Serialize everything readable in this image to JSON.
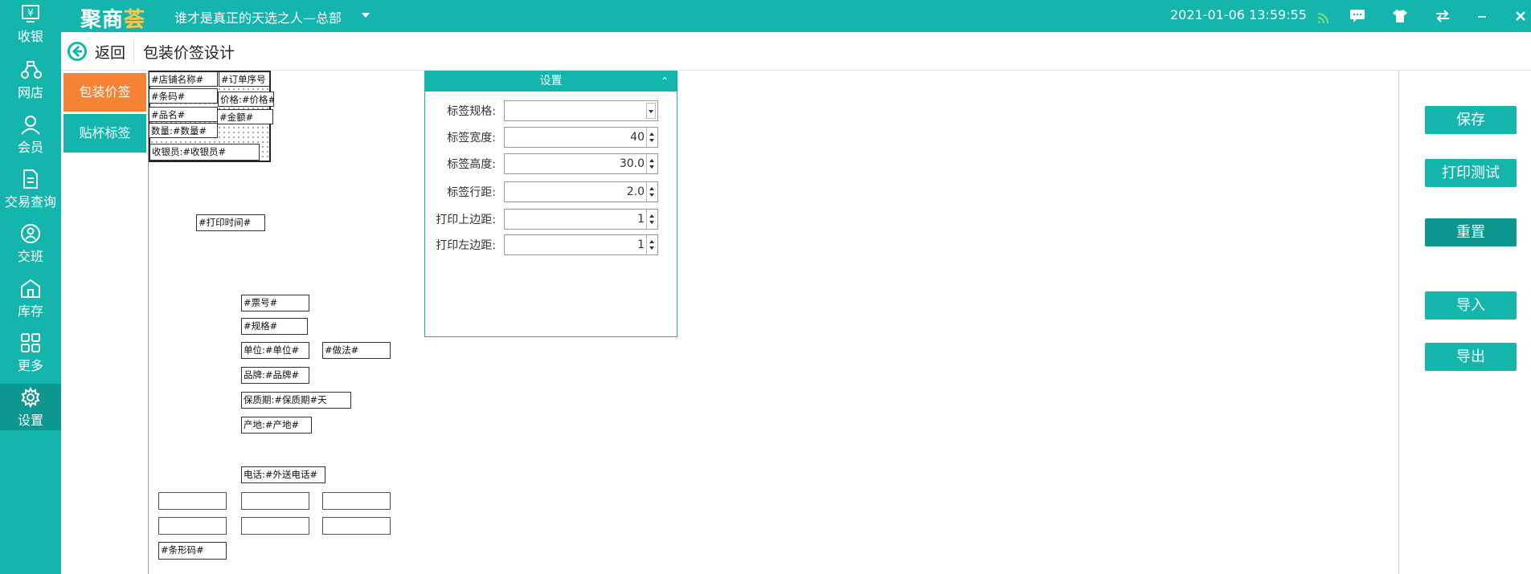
{
  "app": {
    "logo_main": "聚商",
    "logo_accent": "荟"
  },
  "topbar": {
    "store_name": "谁才是真正的天选之人—总部",
    "datetime": "2021-01-06 13:59:55",
    "icons": [
      "wifi-icon",
      "message-icon",
      "shirt-icon",
      "switch-icon",
      "minimize-icon",
      "close-icon"
    ]
  },
  "sidebar": {
    "items": [
      {
        "label": "收银",
        "icon": "cashier-icon"
      },
      {
        "label": "网店",
        "icon": "scooter-icon"
      },
      {
        "label": "会员",
        "icon": "member-icon"
      },
      {
        "label": "交易查询",
        "icon": "document-icon"
      },
      {
        "label": "交班",
        "icon": "shift-icon"
      },
      {
        "label": "库存",
        "icon": "warehouse-icon"
      },
      {
        "label": "更多",
        "icon": "grid-icon"
      },
      {
        "label": "设置",
        "icon": "gear-icon",
        "active": true
      }
    ]
  },
  "header": {
    "back_label": "返回",
    "title": "包装价签设计"
  },
  "tabs": [
    {
      "label": "包装价签",
      "active": true
    },
    {
      "label": "贴杯标签",
      "active": false
    }
  ],
  "fields": {
    "store_name": "#店铺名称#",
    "order_no": "#订单序号",
    "barcode": "#条码#",
    "price": "价格:#价格#",
    "product_name": "#品名#",
    "amount": "#金额#",
    "quantity": "数量:#数量#",
    "cashier": "收银员:#收银员#",
    "print_time": "#打印时间#",
    "ticket_no": "#票号#",
    "spec": "#规格#",
    "unit": "单位:#单位#",
    "method": "#做法#",
    "brand": "品牌:#品牌#",
    "shelf_life": "保质期:#保质期#天",
    "origin": "产地:#产地#",
    "phone": "电话:#外送电话#",
    "barcode_img": "#条形码#"
  },
  "settings": {
    "title": "设置",
    "collapse": "⌃",
    "rows": [
      {
        "label": "标签规格:",
        "value": "",
        "type": "select"
      },
      {
        "label": "标签宽度:",
        "value": "40",
        "type": "spin"
      },
      {
        "label": "标签高度:",
        "value": "30.0",
        "type": "spin"
      },
      {
        "label": "标签行距:",
        "value": "2.0",
        "type": "spin"
      },
      {
        "label": "打印上边距:",
        "value": "1",
        "type": "spin"
      },
      {
        "label": "打印左边距:",
        "value": "1",
        "type": "spin"
      }
    ]
  },
  "actions": {
    "save": "保存",
    "print_test": "打印测试",
    "reset": "重置",
    "import": "导入",
    "export": "导出"
  },
  "colors": {
    "primary": "#14b5ad",
    "primary_dark": "#0e9690",
    "accent": "#f58235",
    "logo_accent": "#ffc64a"
  }
}
